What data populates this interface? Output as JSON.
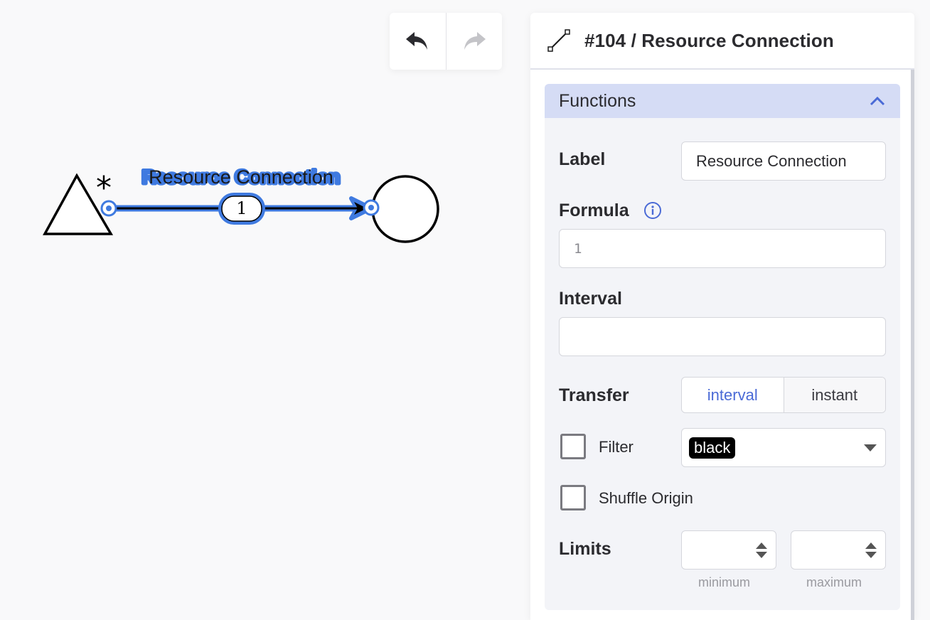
{
  "diagram": {
    "connection_label": "Resource Connection",
    "connection_value": "1",
    "source_symbol": "*"
  },
  "toolbar": {
    "undo_icon": "undo-icon",
    "redo_icon": "redo-icon"
  },
  "panel": {
    "title": "#104 / Resource Connection",
    "icon": "connection-line-icon",
    "section": {
      "title": "Functions",
      "collapsed": false
    },
    "label_field": {
      "label": "Label",
      "value": "Resource Connection"
    },
    "formula_field": {
      "label": "Formula",
      "value": "1",
      "info_icon": "info-icon"
    },
    "interval_field": {
      "label": "Interval",
      "value": ""
    },
    "transfer": {
      "label": "Transfer",
      "options": [
        "interval",
        "instant"
      ],
      "selected": "interval"
    },
    "filter": {
      "label": "Filter",
      "checked": false,
      "selected_value": "black"
    },
    "shuffle_origin": {
      "label": "Shuffle Origin",
      "checked": false
    },
    "limits": {
      "label": "Limits",
      "minimum_hint": "minimum",
      "maximum_hint": "maximum",
      "minimum_value": "",
      "maximum_value": ""
    }
  },
  "colors": {
    "accent": "#4a6ad6",
    "connection_highlight": "#3f7ae0",
    "section_header": "#d5dcf5"
  }
}
